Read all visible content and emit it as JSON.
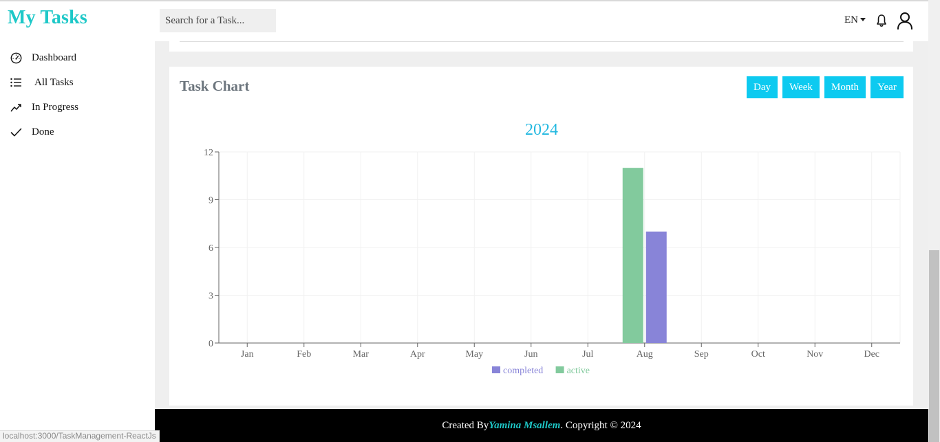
{
  "header": {
    "logo": "My Tasks",
    "search_placeholder": "Search for a Task...",
    "language": "EN"
  },
  "sidebar": {
    "items": [
      {
        "label": "Dashboard",
        "icon": "speedometer-icon"
      },
      {
        "label": "All Tasks",
        "icon": "list-icon"
      },
      {
        "label": "In Progress",
        "icon": "trend-up-icon"
      },
      {
        "label": "Done",
        "icon": "check-icon"
      }
    ]
  },
  "status_bar_url": "localhost:3000/TaskManagement-ReactJs",
  "chart_card": {
    "title": "Task Chart",
    "buttons": [
      "Day",
      "Week",
      "Month",
      "Year"
    ],
    "button_color": "#0dcaf0"
  },
  "chart_data": {
    "type": "bar",
    "title": "2024",
    "categories": [
      "Jan",
      "Feb",
      "Mar",
      "Apr",
      "May",
      "Jun",
      "Jul",
      "Aug",
      "Sep",
      "Oct",
      "Nov",
      "Dec"
    ],
    "series": [
      {
        "name": "completed",
        "color": "#8884d8",
        "values": [
          0,
          0,
          0,
          0,
          0,
          0,
          0,
          7,
          0,
          0,
          0,
          0
        ]
      },
      {
        "name": "active",
        "color": "#82ca9d",
        "values": [
          0,
          0,
          0,
          0,
          0,
          0,
          0,
          11,
          0,
          0,
          0,
          0
        ]
      }
    ],
    "bar_order": [
      "active",
      "completed"
    ],
    "yticks": [
      0,
      3,
      6,
      9,
      12
    ],
    "ylim": [
      0,
      12
    ],
    "grid": true,
    "legend": "bottom-center",
    "title_color": "#22b8e0"
  },
  "footer": {
    "prefix": "Created By",
    "author": "Yamina Msallem",
    "suffix": ". Copyright © 2024"
  }
}
